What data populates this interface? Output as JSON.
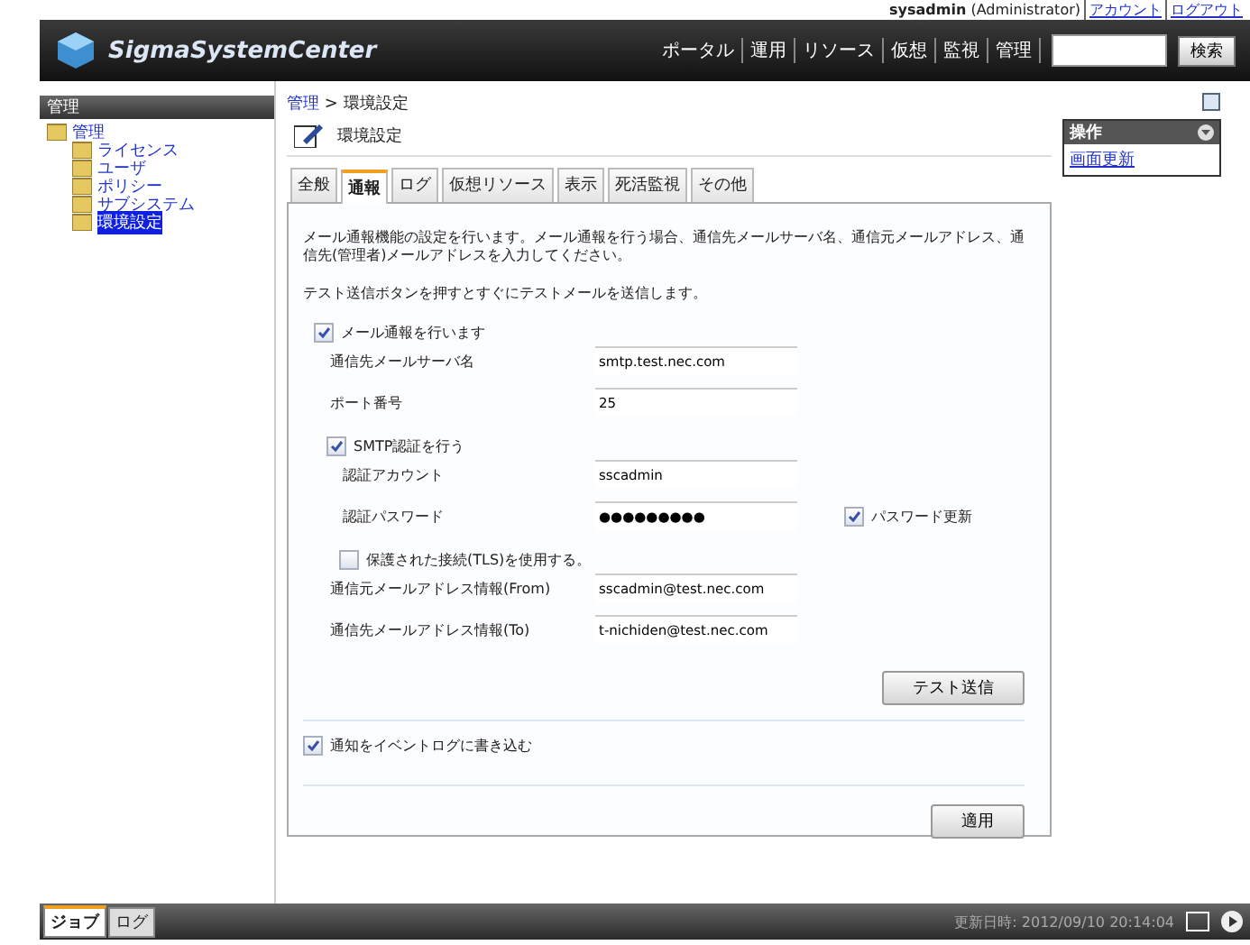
{
  "header": {
    "user": "sysadmin",
    "role": "(Administrator)",
    "links": [
      "アカウント",
      "ログアウト"
    ],
    "logo": "SigmaSystemCenter",
    "nav": [
      "ポータル",
      "運用",
      "リソース",
      "仮想",
      "監視",
      "管理"
    ],
    "search_button": "検索"
  },
  "sidebar": {
    "title": "管理",
    "tree": [
      {
        "label": "管理",
        "selected": false,
        "children": [
          {
            "label": "ライセンス",
            "selected": false
          },
          {
            "label": "ユーザ",
            "selected": false
          },
          {
            "label": "ポリシー",
            "selected": false
          },
          {
            "label": "サブシステム",
            "selected": false
          },
          {
            "label": "環境設定",
            "selected": true
          }
        ]
      }
    ]
  },
  "breadcrumb": [
    "管理",
    ">",
    "環境設定"
  ],
  "page_title": "環境設定",
  "tabs": [
    {
      "label": "全般",
      "selected": false
    },
    {
      "label": "通報",
      "selected": true
    },
    {
      "label": "ログ",
      "selected": false
    },
    {
      "label": "仮想リソース",
      "selected": false
    },
    {
      "label": "表示",
      "selected": false
    },
    {
      "label": "死活監視",
      "selected": false
    },
    {
      "label": "その他",
      "selected": false
    }
  ],
  "description": [
    "メール通報機能の設定を行います。メール通報を行う場合、通信先メールサーバ名、通信元メールアドレス、通信先(管理者)メールアドレスを入力してください。",
    "テスト送信ボタンを押すとすぐにテストメールを送信します。"
  ],
  "rows": [
    {
      "kind": "checkbox",
      "label": "メール通報を行います",
      "checked": true,
      "children": [
        {
          "kind": "field",
          "label": "通信先メールサーバ名",
          "value": "smtp.test.nec.com"
        },
        {
          "kind": "field",
          "label": "ポート番号",
          "value": "25"
        },
        {
          "kind": "checkbox",
          "label": "SMTP認証を行う",
          "checked": true,
          "children": [
            {
              "kind": "field",
              "label": "認証アカウント",
              "value": "sscadmin"
            },
            {
              "kind": "field",
              "label": "認証パスワード",
              "value": "●●●●●●●●●",
              "option": {
                "label": "パスワード更新",
                "checked": true
              }
            },
            {
              "kind": "checkbox",
              "label": "保護された接続(TLS)を使用する。",
              "checked": false
            }
          ]
        },
        {
          "kind": "field",
          "label": "通信元メールアドレス情報(From)",
          "value": "sscadmin@test.nec.com"
        },
        {
          "kind": "field",
          "label": "通信先メールアドレス情報(To)",
          "value": "t-nichiden@test.nec.com"
        }
      ]
    }
  ],
  "test_button": "テスト送信",
  "event_log": {
    "label": "通知をイベントログに書き込む",
    "checked": true
  },
  "apply_button": "適用",
  "operations": {
    "title": "操作",
    "links": [
      "画面更新"
    ]
  },
  "footer": {
    "tabs": [
      {
        "label": "ジョブ",
        "selected": true
      },
      {
        "label": "ログ",
        "selected": false
      }
    ],
    "updated": "更新日時: 2012/09/10 20:14:04"
  }
}
